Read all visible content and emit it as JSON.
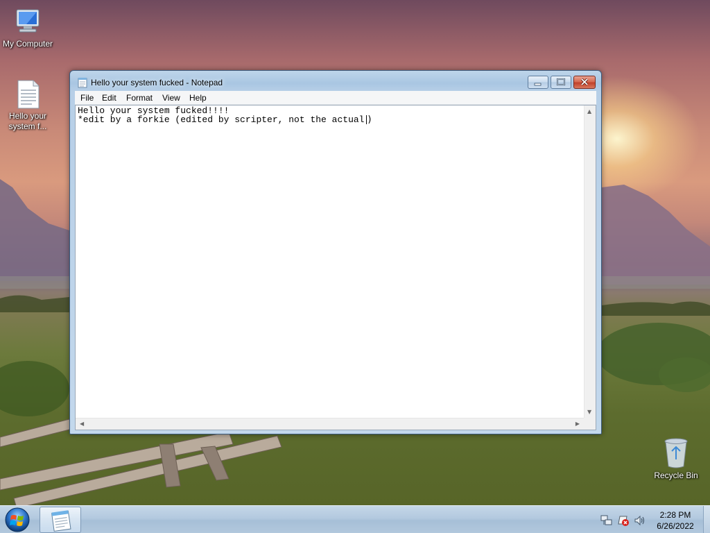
{
  "desktop": {
    "icons": [
      {
        "label": "My Computer",
        "icon": "computer-icon"
      },
      {
        "label": "Hello your system f...",
        "icon": "text-file-icon"
      },
      {
        "label": "Recycle Bin",
        "icon": "recycle-bin-icon"
      }
    ]
  },
  "window": {
    "title": "Hello your system fucked - Notepad",
    "menu": [
      "File",
      "Edit",
      "Format",
      "View",
      "Help"
    ],
    "content_lines": [
      "Hello your system fucked!!!!",
      "*edit by a forkie (edited by scripter, not the actual "
    ]
  },
  "taskbar": {
    "start_icon": "windows-orb-icon",
    "task_icon": "notepad-icon",
    "tray_icons": [
      "network-icon",
      "action-center-icon",
      "volume-icon"
    ],
    "clock": {
      "time": "2:28 PM",
      "date": "6/26/2022"
    }
  },
  "colors": {
    "title_bar": "#b7cfe7",
    "close_button": "#c0412b",
    "taskbar": "#b3c9df"
  }
}
